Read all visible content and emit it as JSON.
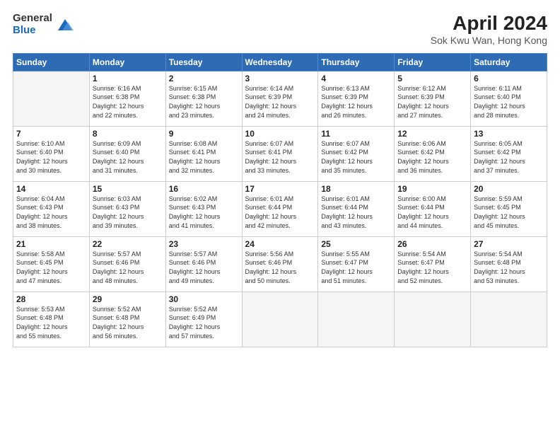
{
  "header": {
    "logo_general": "General",
    "logo_blue": "Blue",
    "month_title": "April 2024",
    "location": "Sok Kwu Wan, Hong Kong"
  },
  "days_of_week": [
    "Sunday",
    "Monday",
    "Tuesday",
    "Wednesday",
    "Thursday",
    "Friday",
    "Saturday"
  ],
  "weeks": [
    [
      {
        "day": "",
        "info": ""
      },
      {
        "day": "1",
        "info": "Sunrise: 6:16 AM\nSunset: 6:38 PM\nDaylight: 12 hours\nand 22 minutes."
      },
      {
        "day": "2",
        "info": "Sunrise: 6:15 AM\nSunset: 6:38 PM\nDaylight: 12 hours\nand 23 minutes."
      },
      {
        "day": "3",
        "info": "Sunrise: 6:14 AM\nSunset: 6:39 PM\nDaylight: 12 hours\nand 24 minutes."
      },
      {
        "day": "4",
        "info": "Sunrise: 6:13 AM\nSunset: 6:39 PM\nDaylight: 12 hours\nand 26 minutes."
      },
      {
        "day": "5",
        "info": "Sunrise: 6:12 AM\nSunset: 6:39 PM\nDaylight: 12 hours\nand 27 minutes."
      },
      {
        "day": "6",
        "info": "Sunrise: 6:11 AM\nSunset: 6:40 PM\nDaylight: 12 hours\nand 28 minutes."
      }
    ],
    [
      {
        "day": "7",
        "info": "Sunrise: 6:10 AM\nSunset: 6:40 PM\nDaylight: 12 hours\nand 30 minutes."
      },
      {
        "day": "8",
        "info": "Sunrise: 6:09 AM\nSunset: 6:40 PM\nDaylight: 12 hours\nand 31 minutes."
      },
      {
        "day": "9",
        "info": "Sunrise: 6:08 AM\nSunset: 6:41 PM\nDaylight: 12 hours\nand 32 minutes."
      },
      {
        "day": "10",
        "info": "Sunrise: 6:07 AM\nSunset: 6:41 PM\nDaylight: 12 hours\nand 33 minutes."
      },
      {
        "day": "11",
        "info": "Sunrise: 6:07 AM\nSunset: 6:42 PM\nDaylight: 12 hours\nand 35 minutes."
      },
      {
        "day": "12",
        "info": "Sunrise: 6:06 AM\nSunset: 6:42 PM\nDaylight: 12 hours\nand 36 minutes."
      },
      {
        "day": "13",
        "info": "Sunrise: 6:05 AM\nSunset: 6:42 PM\nDaylight: 12 hours\nand 37 minutes."
      }
    ],
    [
      {
        "day": "14",
        "info": "Sunrise: 6:04 AM\nSunset: 6:43 PM\nDaylight: 12 hours\nand 38 minutes."
      },
      {
        "day": "15",
        "info": "Sunrise: 6:03 AM\nSunset: 6:43 PM\nDaylight: 12 hours\nand 39 minutes."
      },
      {
        "day": "16",
        "info": "Sunrise: 6:02 AM\nSunset: 6:43 PM\nDaylight: 12 hours\nand 41 minutes."
      },
      {
        "day": "17",
        "info": "Sunrise: 6:01 AM\nSunset: 6:44 PM\nDaylight: 12 hours\nand 42 minutes."
      },
      {
        "day": "18",
        "info": "Sunrise: 6:01 AM\nSunset: 6:44 PM\nDaylight: 12 hours\nand 43 minutes."
      },
      {
        "day": "19",
        "info": "Sunrise: 6:00 AM\nSunset: 6:44 PM\nDaylight: 12 hours\nand 44 minutes."
      },
      {
        "day": "20",
        "info": "Sunrise: 5:59 AM\nSunset: 6:45 PM\nDaylight: 12 hours\nand 45 minutes."
      }
    ],
    [
      {
        "day": "21",
        "info": "Sunrise: 5:58 AM\nSunset: 6:45 PM\nDaylight: 12 hours\nand 47 minutes."
      },
      {
        "day": "22",
        "info": "Sunrise: 5:57 AM\nSunset: 6:46 PM\nDaylight: 12 hours\nand 48 minutes."
      },
      {
        "day": "23",
        "info": "Sunrise: 5:57 AM\nSunset: 6:46 PM\nDaylight: 12 hours\nand 49 minutes."
      },
      {
        "day": "24",
        "info": "Sunrise: 5:56 AM\nSunset: 6:46 PM\nDaylight: 12 hours\nand 50 minutes."
      },
      {
        "day": "25",
        "info": "Sunrise: 5:55 AM\nSunset: 6:47 PM\nDaylight: 12 hours\nand 51 minutes."
      },
      {
        "day": "26",
        "info": "Sunrise: 5:54 AM\nSunset: 6:47 PM\nDaylight: 12 hours\nand 52 minutes."
      },
      {
        "day": "27",
        "info": "Sunrise: 5:54 AM\nSunset: 6:48 PM\nDaylight: 12 hours\nand 53 minutes."
      }
    ],
    [
      {
        "day": "28",
        "info": "Sunrise: 5:53 AM\nSunset: 6:48 PM\nDaylight: 12 hours\nand 55 minutes."
      },
      {
        "day": "29",
        "info": "Sunrise: 5:52 AM\nSunset: 6:48 PM\nDaylight: 12 hours\nand 56 minutes."
      },
      {
        "day": "30",
        "info": "Sunrise: 5:52 AM\nSunset: 6:49 PM\nDaylight: 12 hours\nand 57 minutes."
      },
      {
        "day": "",
        "info": ""
      },
      {
        "day": "",
        "info": ""
      },
      {
        "day": "",
        "info": ""
      },
      {
        "day": "",
        "info": ""
      }
    ]
  ]
}
